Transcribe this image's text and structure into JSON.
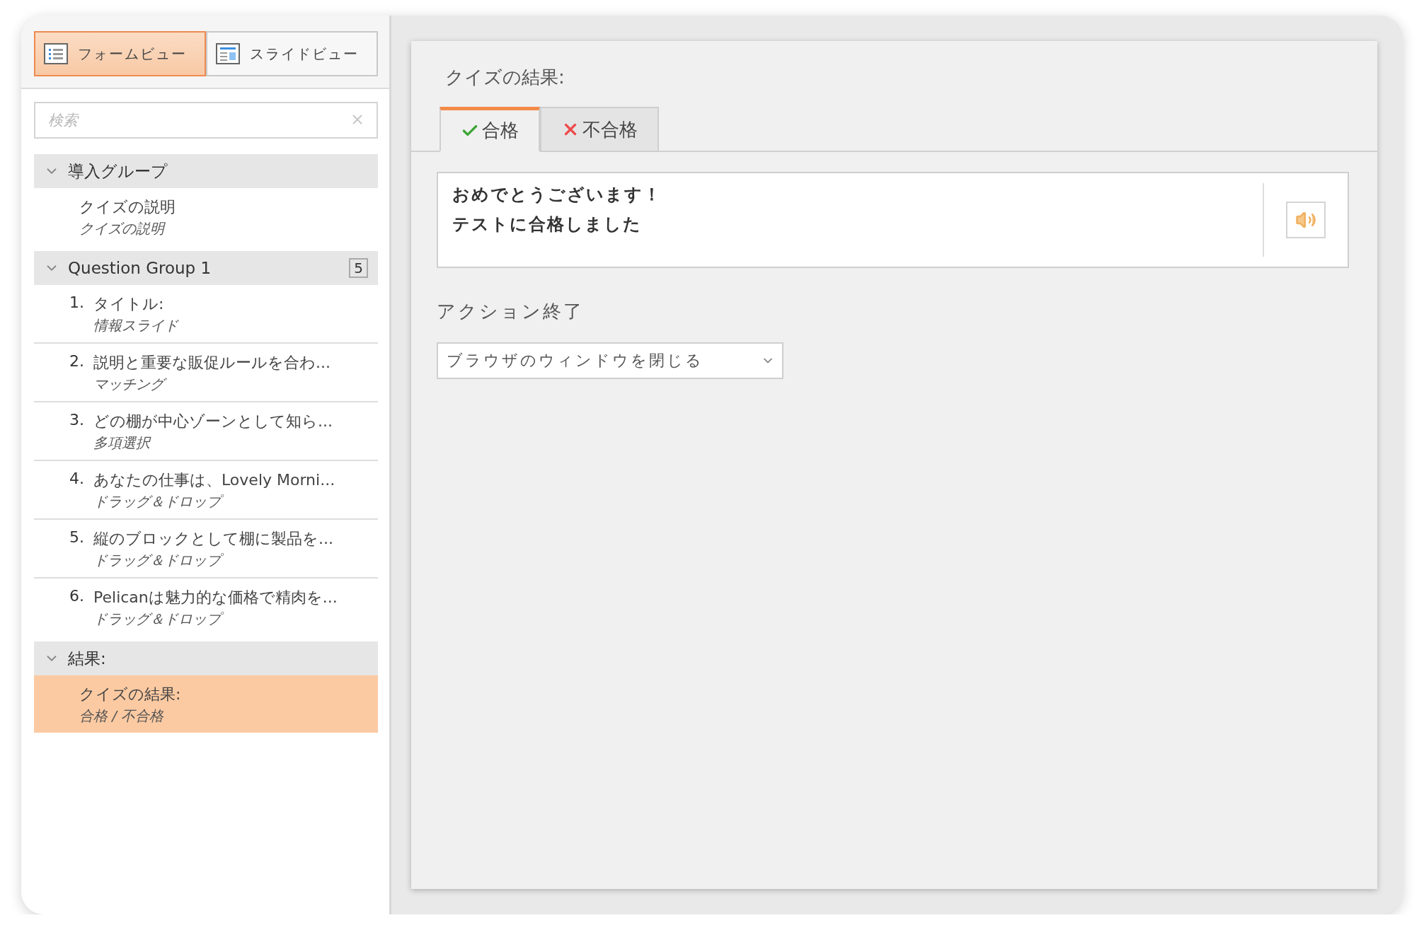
{
  "views": [
    {
      "label": "フォームビュー",
      "kind": "form",
      "selected": true
    },
    {
      "label": "スライドビュー",
      "kind": "slide",
      "selected": false
    }
  ],
  "search": {
    "placeholder": "検索"
  },
  "tree": [
    {
      "label": "導入グループ",
      "expanded": true,
      "children": [
        {
          "title": "クイズの説明",
          "subtitle": "クイズの説明",
          "selected": false
        }
      ]
    },
    {
      "label": "Question Group 1",
      "count": "5",
      "expanded": true,
      "children": [
        {
          "number": "1.",
          "title": "タイトル:",
          "subtitle": "情報スライド",
          "selected": false
        },
        {
          "number": "2.",
          "title": "説明と重要な販促ルールを合わ...",
          "subtitle": "マッチング",
          "selected": false
        },
        {
          "number": "3.",
          "title": "どの棚が中心ゾーンとして知ら...",
          "subtitle": "多項選択",
          "selected": false
        },
        {
          "number": "4.",
          "title": "あなたの仕事は、Lovely Morni...",
          "subtitle": "ドラッグ＆ドロップ",
          "selected": false
        },
        {
          "number": "5.",
          "title": "縦のブロックとして棚に製品を...",
          "subtitle": "ドラッグ＆ドロップ",
          "selected": false
        },
        {
          "number": "6.",
          "title": "Pelicanは魅力的な価格で精肉を...",
          "subtitle": "ドラッグ＆ドロップ",
          "selected": false
        }
      ]
    },
    {
      "label": "結果:",
      "expanded": true,
      "children": [
        {
          "title": "クイズの結果:",
          "subtitle": "合格 / 不合格",
          "selected": true
        }
      ]
    }
  ],
  "main": {
    "title": "クイズの結果:",
    "tabs": [
      {
        "label": "合格",
        "kind": "pass",
        "selected": true
      },
      {
        "label": "不合格",
        "kind": "fail",
        "selected": false
      }
    ],
    "message": [
      "おめでとうございます！",
      "テストに合格しました"
    ],
    "action_label": "アクション終了",
    "action_select": {
      "value": "ブラウザのウィンドウを閉じる"
    }
  }
}
